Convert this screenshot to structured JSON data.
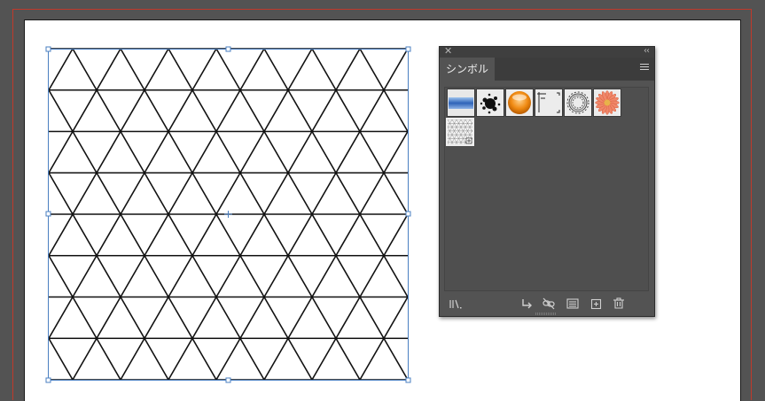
{
  "canvas": {
    "background_color": "#535353",
    "artboard_color": "#ffffff",
    "bleed_color": "#c0392b",
    "selection_color": "#4a7fc1",
    "artwork": {
      "pattern": "triangle-grid",
      "stroke_color": "#111111"
    }
  },
  "symbols_panel": {
    "tab_label": "シンボル",
    "close_icon": "close-icon",
    "collapse_icon": "collapse-double-chevron-icon",
    "menu_icon": "panel-menu-icon",
    "symbols": [
      {
        "icon": "blue-gradient-bar-symbol-icon"
      },
      {
        "icon": "ink-splatter-symbol-icon"
      },
      {
        "icon": "orange-orb-symbol-icon"
      },
      {
        "icon": "crop-marks-symbol-icon"
      },
      {
        "icon": "wreath-ribbon-symbol-icon"
      },
      {
        "icon": "pink-flower-symbol-icon"
      },
      {
        "icon": "triangle-pattern-symbol-icon",
        "selected": true
      }
    ],
    "footer_buttons": [
      {
        "icon": "symbol-libraries-menu-icon"
      },
      {
        "icon": "place-symbol-instance-icon"
      },
      {
        "icon": "break-link-icon"
      },
      {
        "icon": "symbol-options-icon"
      },
      {
        "icon": "new-symbol-icon"
      },
      {
        "icon": "delete-symbol-icon"
      }
    ]
  }
}
